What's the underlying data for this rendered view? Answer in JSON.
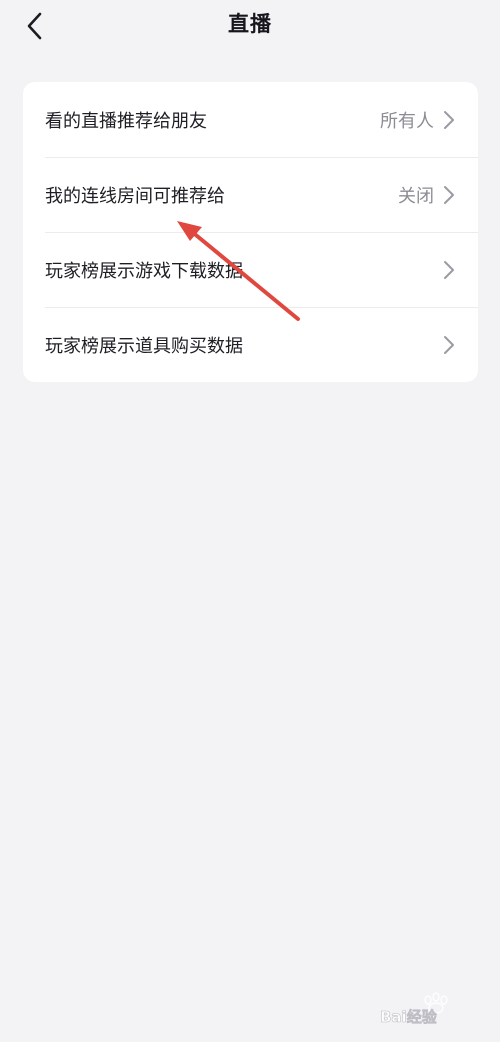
{
  "header": {
    "title": "直播",
    "back_icon": "chevron-left-icon"
  },
  "settings": {
    "items": [
      {
        "label": "看的直播推荐给朋友",
        "value": "所有人"
      },
      {
        "label": "我的连线房间可推荐给",
        "value": "关闭"
      },
      {
        "label": "玩家榜展示游戏下载数据",
        "value": ""
      },
      {
        "label": "玩家榜展示道具购买数据",
        "value": ""
      }
    ],
    "chevron_icon": "chevron-right-icon"
  },
  "annotation": {
    "arrow_color": "#e0483f",
    "points_to": "我的连线房间可推荐给"
  },
  "watermark": {
    "text": "Bai经验"
  },
  "colors": {
    "background": "#f3f3f5",
    "card": "#ffffff",
    "text_primary": "#1e1e25",
    "text_secondary": "#8c8c94",
    "divider": "#ececef"
  }
}
